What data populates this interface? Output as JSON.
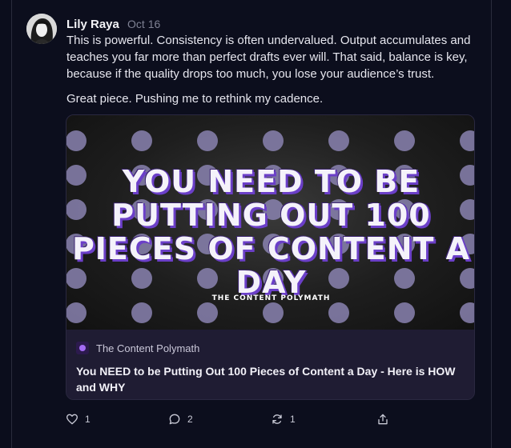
{
  "post": {
    "author": "Lily Raya",
    "date": "Oct 16",
    "paragraphs": [
      "This is powerful. Consistency is often undervalued. Output accumulates and teaches you far more than perfect drafts ever will. That said, balance is key, because if the quality drops too much, you lose your audience’s trust.",
      "Great piece. Pushing me to rethink my cadence."
    ]
  },
  "link_card": {
    "image_headline": "YOU NEED TO BE PUTTING OUT 100 PIECES OF CONTENT A DAY",
    "image_caption": "THE CONTENT POLYMATH",
    "source_name": "The Content Polymath",
    "title": "You NEED to be Putting Out 100 Pieces of Content a Day - Here is HOW and WHY"
  },
  "actions": {
    "likes": "1",
    "replies": "2",
    "reposts": "1"
  },
  "icons": {
    "like": "heart-icon",
    "reply": "speech-bubble-icon",
    "repost": "repost-arrows-icon",
    "share": "share-icon"
  },
  "colors": {
    "background": "#0c0e1d",
    "card_meta_bg": "#1f1c33",
    "headline_shadow": "#6b3fc8",
    "dots": "#8a82b0"
  }
}
